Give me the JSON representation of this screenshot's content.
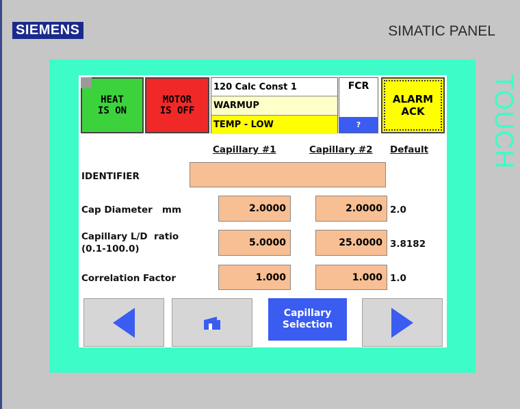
{
  "header": {
    "brand": "SIEMENS",
    "model": "SIMATIC PANEL",
    "side_label": "TOUCH"
  },
  "status_bar": {
    "heat_line1": "HEAT",
    "heat_line2": "IS ON",
    "motor_line1": "MOTOR",
    "motor_line2": "IS OFF",
    "calc_const": "120 Calc Const 1",
    "mode": "WARMUP",
    "alarm_text": "TEMP - LOW",
    "fcr_label": "FCR",
    "fcr_indicator": "?",
    "alarm_ack_line1": "ALARM",
    "alarm_ack_line2": "ACK"
  },
  "columns": {
    "capillary1": "Capillary #1",
    "capillary2": "Capillary #2",
    "default": "Default"
  },
  "rows": {
    "identifier": {
      "label": "IDENTIFIER",
      "value": ""
    },
    "cap_diameter": {
      "label": "Cap Diameter   mm",
      "cap1": "2.0000",
      "cap2": "2.0000",
      "default": "2.0"
    },
    "ld_ratio": {
      "label_line1": "Capillary L/D  ratio",
      "label_line2": "(0.1-100.0)",
      "cap1": "5.0000",
      "cap2": "25.0000",
      "default": "3.8182"
    },
    "correlation": {
      "label": "Correlation Factor",
      "cap1": "1.000",
      "cap2": "1.000",
      "default": "1.0"
    }
  },
  "nav": {
    "selection_line1": "Capillary",
    "selection_line2": "Selection"
  },
  "colors": {
    "heat_on": "#3cd23c",
    "motor_off": "#f02828",
    "alarm_yellow": "#ffff00",
    "bezel": "#3dfcc8",
    "field": "#f7bf93",
    "accent_blue": "#3a5cf0"
  },
  "icons": {
    "prev": "left-triangle",
    "home": "home-icon",
    "next": "right-triangle"
  }
}
